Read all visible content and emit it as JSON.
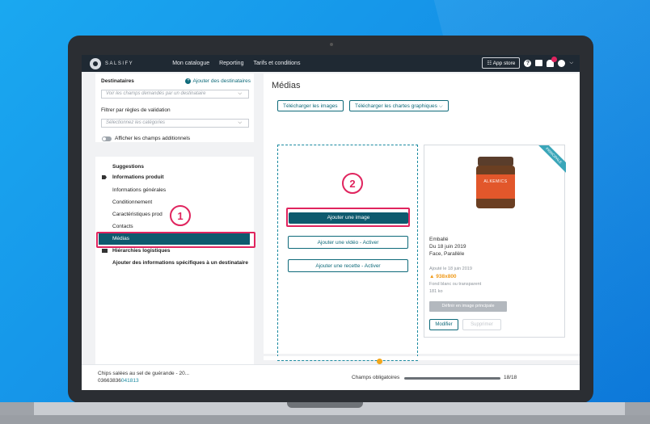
{
  "app": {
    "logo_text": "SALSIFY",
    "nav": [
      "Mon catalogue",
      "Reporting",
      "Tarifs et conditions"
    ],
    "app_store": "☷ App store"
  },
  "left": {
    "destinataires_label": "Destinataires",
    "add_dest": "Ajouter des destinataires",
    "dest_placeholder": "Voir les champs demandés par un destinataire",
    "filter_label": "Filtrer par règles de validation",
    "categories_placeholder": "Sélectionnez les catégories",
    "toggle_label": "Afficher les champs additionnels",
    "suggestions": "Suggestions",
    "items": {
      "info_produit": "Informations produit",
      "info_generales": "Informations générales",
      "conditionnement": "Conditionnement",
      "caracteristiques": "Caractéristiques prod",
      "contacts": "Contacts",
      "medias": "Médias",
      "hierarchies": "Hiérarchies logistiques",
      "ajouter_infos": "Ajouter des informations spécifiques à un destinataire"
    }
  },
  "main": {
    "title": "Médias",
    "btn_download_images": "Télécharger les images",
    "btn_download_charts": "Télécharger les chartes graphiques  ⌵",
    "btn_add_image": "Ajouter une image",
    "btn_add_video": "Ajouter une vidéo - Activer",
    "btn_add_recipe": "Ajouter une recette - Activer",
    "card": {
      "ribbon": "PRINCIPALE",
      "jar_brand": "ALKEMICS",
      "line1": "Emballé",
      "line2": "Du 18 juin 2019",
      "line3": "Face, Parallèle",
      "added": "Ajouté le 18 juin 2019",
      "warn": "▲ 938x800",
      "bg": "Fond blanc ou transparent",
      "size": "181 ko",
      "btn_main": "Définir en image principale",
      "btn_modify": "Modifier",
      "btn_delete": "Supprimer"
    }
  },
  "annotations": {
    "one": "1",
    "two": "2"
  },
  "footer": {
    "product_name": "Chips salées au sel de guérande - 20...",
    "code_prefix": "03663836",
    "code_suffix": "041813",
    "required_label": "Champs obligatoires",
    "count": "18/18",
    "progress": 1.0
  },
  "colors": {
    "accent": "#0e5a6e",
    "highlight": "#e0245e",
    "warning": "#f09a1a"
  }
}
